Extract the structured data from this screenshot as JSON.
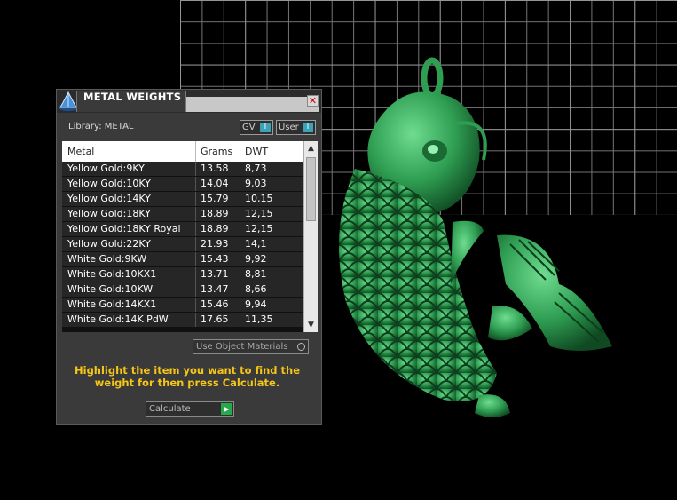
{
  "window": {
    "title": "METAL WEIGHTS",
    "close_glyph": "✕"
  },
  "library": {
    "label": "Library: METAL"
  },
  "toggles": {
    "gv_label": "GV",
    "user_label": "User",
    "knob_glyph": "I"
  },
  "table": {
    "headers": [
      "Metal",
      "Grams",
      "DWT"
    ],
    "rows": [
      {
        "metal": "Yellow Gold:9KY",
        "grams": "13.58",
        "dwt": "8,73"
      },
      {
        "metal": "Yellow Gold:10KY",
        "grams": "14.04",
        "dwt": "9,03"
      },
      {
        "metal": "Yellow Gold:14KY",
        "grams": "15.79",
        "dwt": "10,15"
      },
      {
        "metal": "Yellow Gold:18KY",
        "grams": "18.89",
        "dwt": "12,15"
      },
      {
        "metal": "Yellow Gold:18KY Royal",
        "grams": "18.89",
        "dwt": "12,15"
      },
      {
        "metal": "Yellow Gold:22KY",
        "grams": "21.93",
        "dwt": "14,1"
      },
      {
        "metal": "White Gold:9KW",
        "grams": "15.43",
        "dwt": "9,92"
      },
      {
        "metal": "White Gold:10KX1",
        "grams": "13.71",
        "dwt": "8,81"
      },
      {
        "metal": "White Gold:10KW",
        "grams": "13.47",
        "dwt": "8,66"
      },
      {
        "metal": "White Gold:14KX1",
        "grams": "15.46",
        "dwt": "9,94"
      },
      {
        "metal": "White Gold:14K PdW",
        "grams": "17.65",
        "dwt": "11,35"
      }
    ],
    "scroll_fraction": 0
  },
  "options": {
    "use_object_materials": "Use Object Materials"
  },
  "instructions": "Highlight the item you want to find the weight for then press Calculate.",
  "calculate": {
    "label": "Calculate"
  },
  "colors": {
    "accent_yellow": "#f5c518",
    "toggle_blue": "#3aa3b8",
    "go_green": "#27a84a",
    "model_green": "#2f9e52"
  },
  "icons": {
    "app": "pyramid-app-icon",
    "close": "close-icon",
    "scroll_up": "scroll-up-arrow-icon",
    "scroll_down": "scroll-down-arrow-icon",
    "calculate": "play-arrow-icon"
  }
}
